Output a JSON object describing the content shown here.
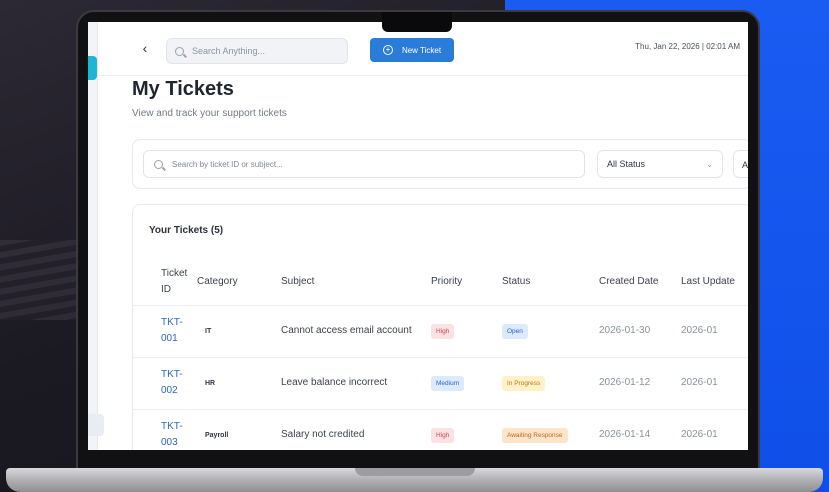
{
  "topbar": {
    "back_icon": "chevron-left-icon",
    "search_placeholder": "Search Anything...",
    "new_ticket_label": "New Ticket",
    "datetime": "Thu, Jan 22, 2026 | 02:01 AM"
  },
  "header": {
    "title": "My Tickets",
    "subtitle": "View and track your support tickets"
  },
  "filters": {
    "search_placeholder": "Search by ticket ID or subject...",
    "status_value": "All Status",
    "second_select_value": "A"
  },
  "tickets": {
    "heading": "Your Tickets (5)",
    "columns": {
      "id": "Ticket ID",
      "category": "Category",
      "subject": "Subject",
      "priority": "Priority",
      "status": "Status",
      "created": "Created Date",
      "updated": "Last Update"
    },
    "rows": [
      {
        "id": "TKT-001",
        "category": "IT",
        "subject": "Cannot access email account",
        "priority": "High",
        "status": "Open",
        "created": "2026-01-30",
        "updated": "2026-01"
      },
      {
        "id": "TKT-002",
        "category": "HR",
        "subject": "Leave balance incorrect",
        "priority": "Medium",
        "status": "In Progress",
        "created": "2026-01-12",
        "updated": "2026-01"
      },
      {
        "id": "TKT-003",
        "category": "Payroll",
        "subject": "Salary not credited",
        "priority": "High",
        "status": "Awaiting Response",
        "created": "2026-01-14",
        "updated": "2026-01"
      }
    ]
  },
  "colors": {
    "accent": "#2a7cd8",
    "sidebar_active": "#1fb6d6",
    "background_right": "#1a5cf2"
  }
}
